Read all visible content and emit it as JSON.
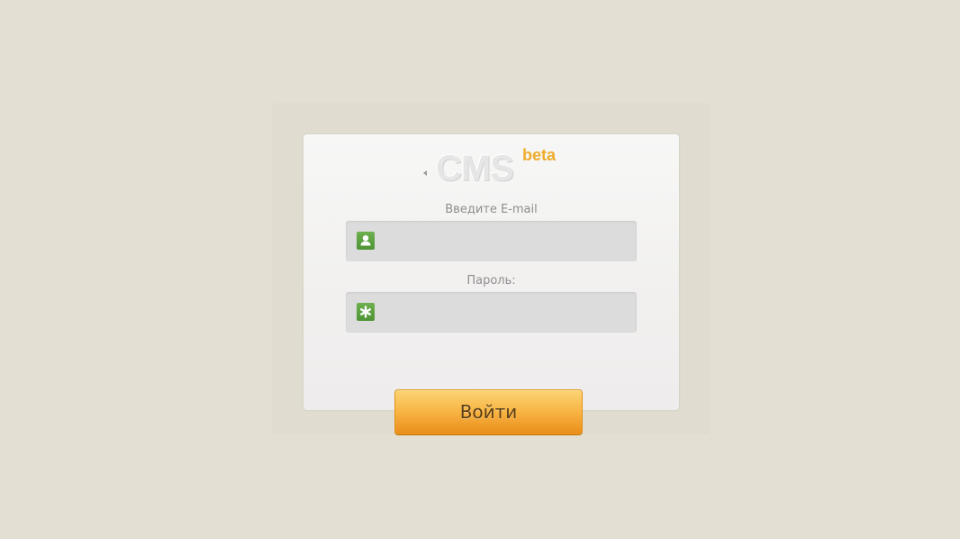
{
  "logo": {
    "text": "CMS",
    "badge": "beta"
  },
  "form": {
    "email_label": "Введите E-mail",
    "email_value": "",
    "password_label": "Пароль:",
    "password_value": "",
    "submit_label": "Войти"
  },
  "icons": {
    "email_field": "user-icon",
    "password_field": "asterisk-icon",
    "logo_arrow": "caret-left-icon"
  },
  "colors": {
    "background": "#e3e0d3",
    "accent_orange": "#f8b443",
    "icon_green": "#5aa040",
    "beta_text": "#eeac2b"
  }
}
